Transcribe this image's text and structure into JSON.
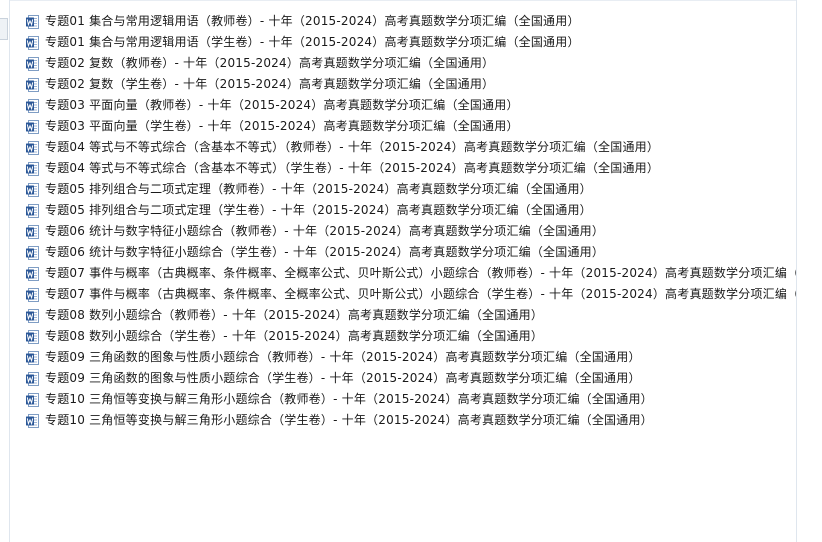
{
  "files": [
    {
      "name": "专题01 集合与常用逻辑用语（教师卷）- 十年（2015-2024）高考真题数学分项汇编（全国通用）",
      "icon": "word-doc-icon"
    },
    {
      "name": "专题01 集合与常用逻辑用语（学生卷）- 十年（2015-2024）高考真题数学分项汇编（全国通用）",
      "icon": "word-doc-icon"
    },
    {
      "name": "专题02 复数（教师卷）- 十年（2015-2024）高考真题数学分项汇编（全国通用）",
      "icon": "word-doc-icon"
    },
    {
      "name": "专题02 复数（学生卷）- 十年（2015-2024）高考真题数学分项汇编（全国通用）",
      "icon": "word-doc-icon"
    },
    {
      "name": "专题03 平面向量（教师卷）- 十年（2015-2024）高考真题数学分项汇编（全国通用）",
      "icon": "word-doc-icon"
    },
    {
      "name": "专题03 平面向量（学生卷）- 十年（2015-2024）高考真题数学分项汇编（全国通用）",
      "icon": "word-doc-icon"
    },
    {
      "name": "专题04 等式与不等式综合（含基本不等式）（教师卷）- 十年（2015-2024）高考真题数学分项汇编（全国通用）",
      "icon": "word-doc-icon"
    },
    {
      "name": "专题04 等式与不等式综合（含基本不等式）（学生卷）- 十年（2015-2024）高考真题数学分项汇编（全国通用）",
      "icon": "word-doc-icon"
    },
    {
      "name": "专题05 排列组合与二项式定理（教师卷）- 十年（2015-2024）高考真题数学分项汇编（全国通用）",
      "icon": "word-doc-icon"
    },
    {
      "name": "专题05 排列组合与二项式定理（学生卷）- 十年（2015-2024）高考真题数学分项汇编（全国通用）",
      "icon": "word-doc-icon"
    },
    {
      "name": "专题06 统计与数字特征小题综合（教师卷）- 十年（2015-2024）高考真题数学分项汇编（全国通用）",
      "icon": "word-doc-icon"
    },
    {
      "name": "专题06 统计与数字特征小题综合（学生卷）- 十年（2015-2024）高考真题数学分项汇编（全国通用）",
      "icon": "word-doc-icon"
    },
    {
      "name": "专题07 事件与概率（古典概率、条件概率、全概率公式、贝叶斯公式）小题综合（教师卷）- 十年（2015-2024）高考真题数学分项汇编（全",
      "icon": "word-doc-icon"
    },
    {
      "name": "专题07 事件与概率（古典概率、条件概率、全概率公式、贝叶斯公式）小题综合（学生卷）- 十年（2015-2024）高考真题数学分项汇编（全",
      "icon": "word-doc-icon"
    },
    {
      "name": "专题08 数列小题综合（教师卷）- 十年（2015-2024）高考真题数学分项汇编（全国通用）",
      "icon": "word-doc-icon"
    },
    {
      "name": "专题08 数列小题综合（学生卷）- 十年（2015-2024）高考真题数学分项汇编（全国通用）",
      "icon": "word-doc-icon"
    },
    {
      "name": "专题09 三角函数的图象与性质小题综合（教师卷）- 十年（2015-2024）高考真题数学分项汇编（全国通用）",
      "icon": "word-doc-icon"
    },
    {
      "name": "专题09 三角函数的图象与性质小题综合（学生卷）- 十年（2015-2024）高考真题数学分项汇编（全国通用）",
      "icon": "word-doc-icon"
    },
    {
      "name": "专题10 三角恒等变换与解三角形小题综合（教师卷）- 十年（2015-2024）高考真题数学分项汇编（全国通用）",
      "icon": "word-doc-icon"
    },
    {
      "name": "专题10 三角恒等变换与解三角形小题综合（学生卷）- 十年（2015-2024）高考真题数学分项汇编（全国通用）",
      "icon": "word-doc-icon"
    }
  ],
  "colors": {
    "word_blue": "#2b5797",
    "word_light": "#5b8fd6",
    "text": "#1a1a1a",
    "border": "#dfe6ee"
  }
}
